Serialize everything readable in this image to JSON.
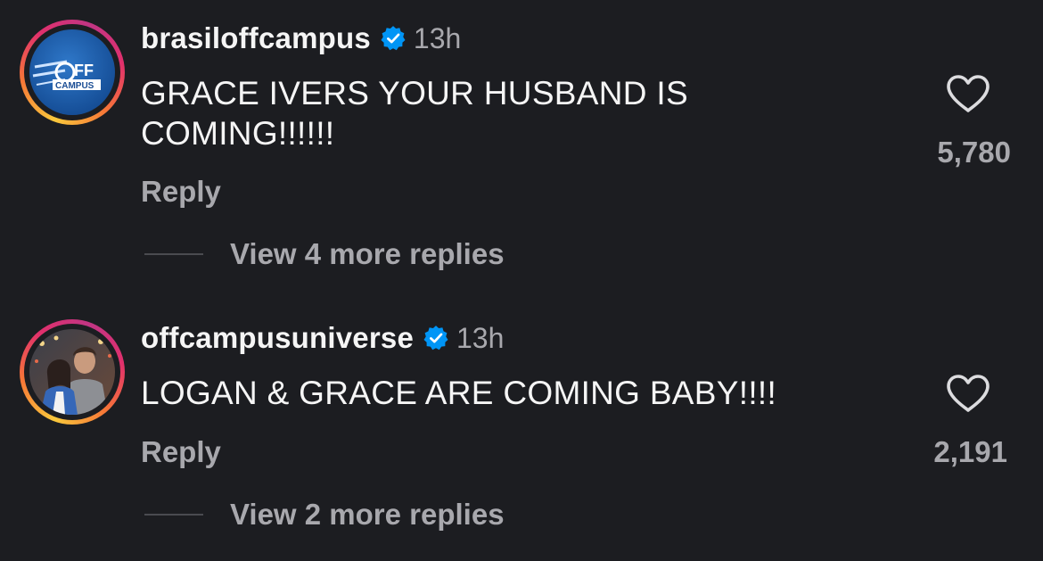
{
  "comments": [
    {
      "username": "brasiloffcampus",
      "verified": true,
      "time": "13h",
      "text": "GRACE IVERS YOUR HUSBAND IS COMING!!!!!!",
      "reply_label": "Reply",
      "likes": "5,780",
      "view_replies": "View 4 more replies",
      "avatar": {
        "logo_text_top": "OFF",
        "logo_text_bottom": "CAMPUS"
      }
    },
    {
      "username": "offcampusuniverse",
      "verified": true,
      "time": "13h",
      "text": "LOGAN & GRACE ARE COMING BABY!!!!",
      "reply_label": "Reply",
      "likes": "2,191",
      "view_replies": "View 2 more replies"
    }
  ],
  "icons": {
    "verified": "verified-badge-icon",
    "like": "heart-outline-icon"
  },
  "colors": {
    "background": "#1c1d21",
    "primary_text": "#f5f5f5",
    "secondary_text": "#a8a8ad",
    "verified_blue": "#0095f6"
  }
}
